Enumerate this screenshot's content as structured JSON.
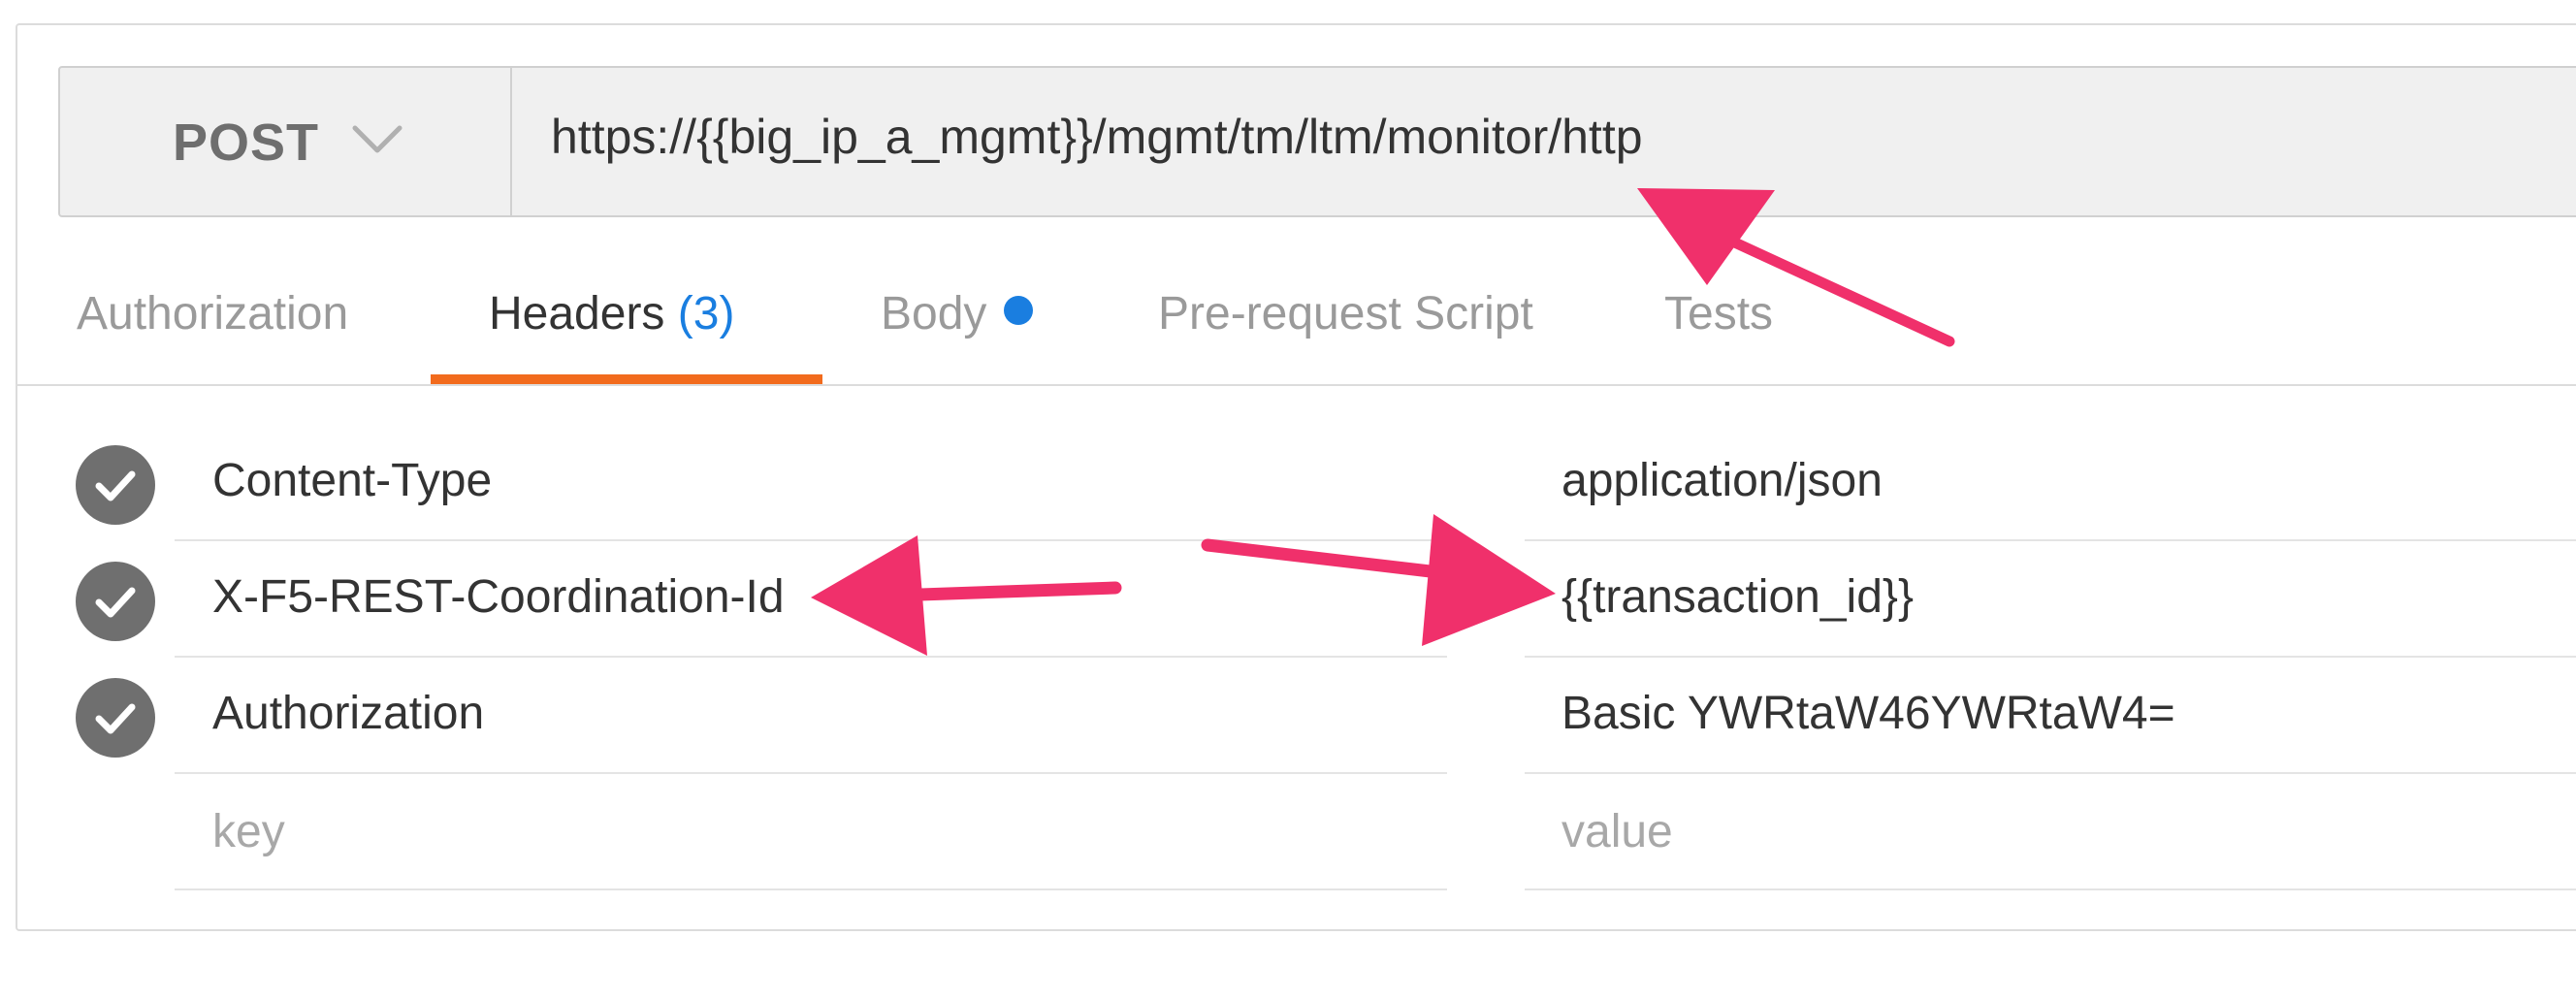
{
  "request": {
    "method": "POST",
    "url": "https://{{big_ip_a_mgmt}}/mgmt/tm/ltm/monitor/http"
  },
  "tabs": [
    {
      "label": "Authorization"
    },
    {
      "label": "Headers",
      "count": "(3)"
    },
    {
      "label": "Body"
    },
    {
      "label": "Pre-request Script"
    },
    {
      "label": "Tests"
    }
  ],
  "active_tab": "Headers",
  "headers": [
    {
      "key": "Content-Type",
      "value": "application/json",
      "enabled": true
    },
    {
      "key": "X-F5-REST-Coordination-Id",
      "value": "{{transaction_id}}",
      "enabled": true
    },
    {
      "key": "Authorization",
      "value": "Basic YWRtaW46YWRtaW4=",
      "enabled": true
    }
  ],
  "new_header": {
    "key_placeholder": "key",
    "value_placeholder": "value"
  },
  "icons": {
    "method_dropdown": "chevron-down-icon",
    "row_enabled": "checkmark-circle-icon",
    "body_indicator": "dot-icon",
    "annotation": "arrow-annotation-icon"
  },
  "colors": {
    "accent": "#f26b1d",
    "link": "#1a7ee0",
    "annotation": "#f0306b",
    "check": "#6f6f6f"
  }
}
